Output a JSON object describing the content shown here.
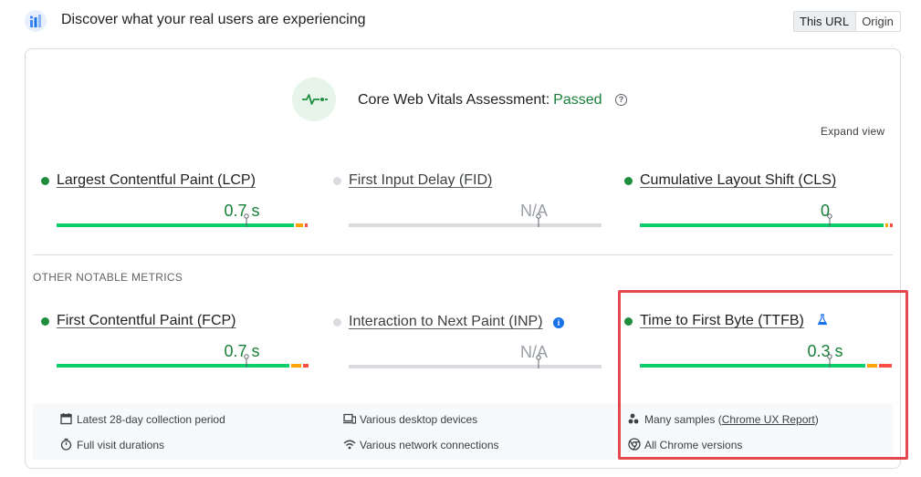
{
  "header": {
    "title": "Discover what your real users are experiencing",
    "toggle": {
      "this_url": "This URL",
      "origin": "Origin",
      "selected": "This URL"
    }
  },
  "assessment": {
    "label": "Core Web Vitals Assessment:",
    "status": "Passed",
    "status_color": "#188038",
    "expand_label": "Expand view"
  },
  "core_metrics": [
    {
      "name": "Largest Contentful Paint (LCP)",
      "value": "0.7 s",
      "status": "good",
      "marker_fraction": 0.75,
      "bar": [
        0.94,
        0.03,
        0.01
      ]
    },
    {
      "name": "First Input Delay (FID)",
      "value": "N/A",
      "status": "none",
      "marker_fraction": 0.75,
      "bar": [
        1.0
      ]
    },
    {
      "name": "Cumulative Layout Shift (CLS)",
      "value": "0",
      "status": "good",
      "marker_fraction": 0.75,
      "bar": [
        0.98,
        0.01,
        0.01
      ]
    }
  ],
  "other_section_label": "OTHER NOTABLE METRICS",
  "other_metrics": [
    {
      "name": "First Contentful Paint (FCP)",
      "value": "0.7 s",
      "status": "good",
      "marker_fraction": 0.75,
      "bar": [
        0.92,
        0.04,
        0.02
      ]
    },
    {
      "name": "Interaction to Next Paint (INP)",
      "value": "N/A",
      "status": "none",
      "marker_fraction": 0.75,
      "bar": [
        1.0
      ]
    },
    {
      "name": "Time to First Byte (TTFB)",
      "value": "0.3 s",
      "status": "good",
      "marker_fraction": 0.75,
      "bar": [
        0.89,
        0.04,
        0.05
      ]
    }
  ],
  "footer": {
    "period": "Latest 28-day collection period",
    "durations": "Full visit durations",
    "devices": "Various desktop devices",
    "network": "Various network connections",
    "samples_prefix": "Many samples (",
    "samples_link": "Chrome UX Report",
    "samples_suffix": ")",
    "versions": "All Chrome versions"
  },
  "colors": {
    "good": "#1e8e3e",
    "bar_good": "#0cce6b",
    "bar_ni": "#ffa400",
    "bar_poor": "#ff4e42",
    "bar_none": "#dadce0",
    "dot_none": "#dadce0",
    "highlight": "#e5484d"
  },
  "icons": {
    "logo": "crux-logo-icon",
    "assessment": "pulse-icon",
    "help": "help-circle-icon",
    "experimental": "flask-icon",
    "info": "info-icon",
    "calendar": "calendar-icon",
    "timer": "timer-icon",
    "devices": "devices-icon",
    "wifi": "wifi-icon",
    "people": "people-icon",
    "chrome": "chrome-icon"
  }
}
